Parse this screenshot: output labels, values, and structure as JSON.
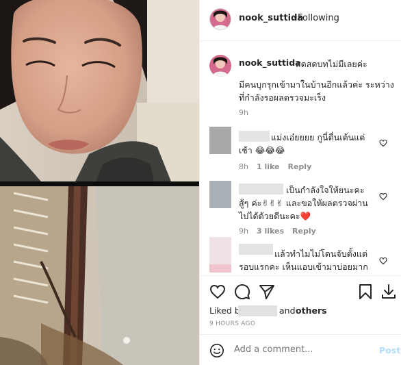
{
  "header": {
    "username": "nook_suttida",
    "separator": "•",
    "follow_status": "Following"
  },
  "caption": {
    "username": "nook_suttida",
    "text_line1": "สดสดบทไม่มีเลยค่ะ",
    "text_line2": "มีคนบุกรุกเข้ามาในบ้านอีกแล้วค่ะ ระหว่างที่กำลังรอผลตรวจมะเร็ง",
    "time": "9h"
  },
  "comments": [
    {
      "text": "แม่งเอ๋ยยยย กูนี่ตื่นเต้นแต่เช้า 😂😂😂",
      "time": "8h",
      "likes": "1 like",
      "reply": "Reply"
    },
    {
      "text": "เป็นกำลังใจให้ยนะคะ สู้ๆ ค่ะ✌✌✌ และขอให้ผลตรวจผ่านไปได้ด้วยดีนะคะ❤️",
      "time": "9h",
      "likes": "3 likes",
      "reply": "Reply"
    },
    {
      "text": "แล้วทำไมไม่โดนจับตั้งแต่รอบแรกคะ เห็นแอบเข้ามาบ่อยมาก",
      "time": "",
      "likes": "",
      "reply": ""
    }
  ],
  "likes": {
    "prefix": "Liked by",
    "and": "and",
    "others": "others"
  },
  "timestamp": "9 HOURS AGO",
  "comment_box": {
    "placeholder": "Add a comment...",
    "post_label": "Post"
  },
  "icons": {
    "like": "heart-icon",
    "comment": "comment-bubble-icon",
    "share": "paper-plane-icon",
    "save": "bookmark-icon",
    "download": "download-icon",
    "emoji": "smiley-icon"
  },
  "colors": {
    "text": "#262626",
    "secondary": "#8e8e8e",
    "post_button": "#b2dffc",
    "heart_red": "#ed4956"
  }
}
